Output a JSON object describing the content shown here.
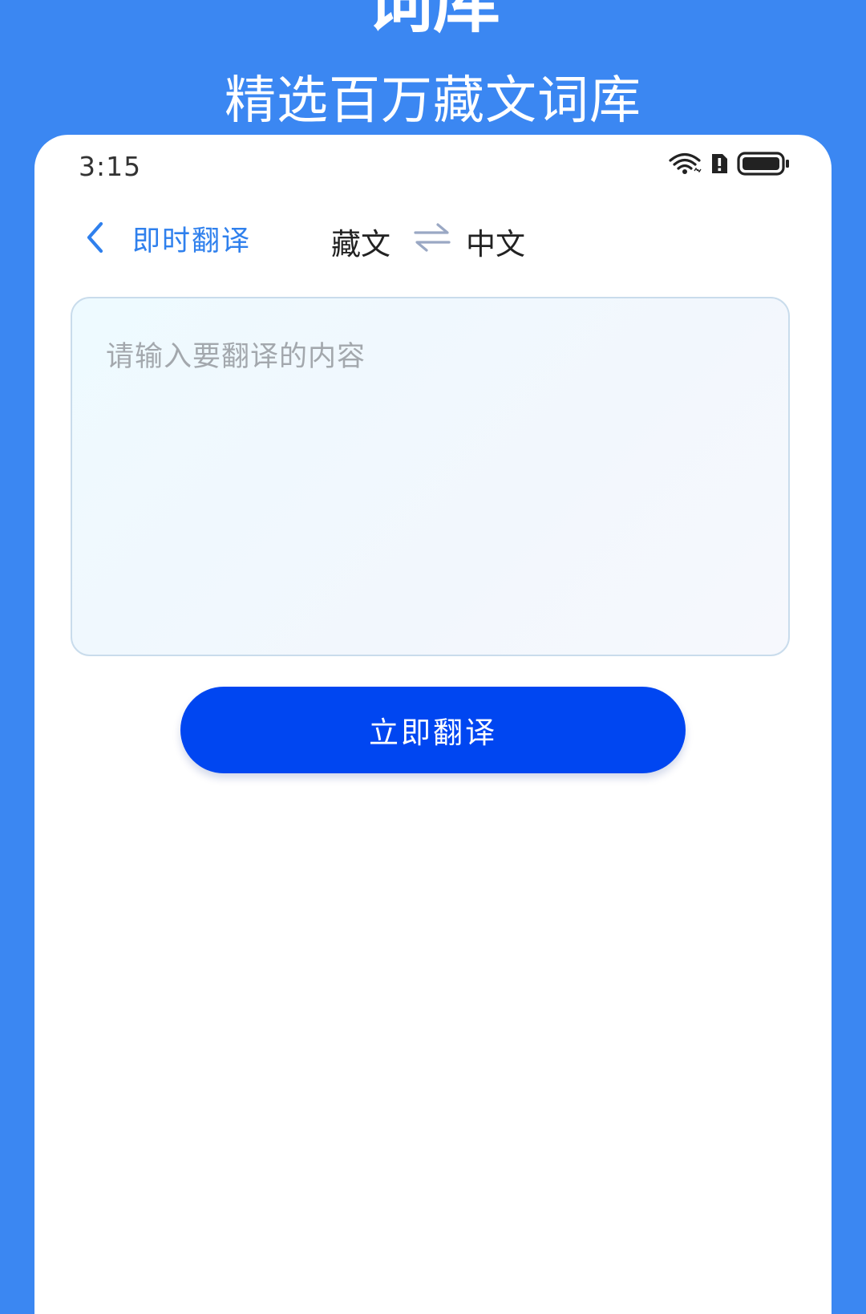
{
  "promo": {
    "heading": "词库",
    "subtitle": "精选百万藏文词库"
  },
  "status_bar": {
    "time": "3:15",
    "icons": [
      "wifi-icon",
      "alert-icon",
      "battery-icon"
    ]
  },
  "nav": {
    "back_icon": "chevron-left-icon",
    "title": "即时翻译",
    "source_language": "藏文",
    "swap_icon": "swap-arrows-icon",
    "target_language": "中文"
  },
  "input": {
    "value": "",
    "placeholder": "请输入要翻译的内容"
  },
  "actions": {
    "translate_label": "立即翻译"
  },
  "colors": {
    "background": "#3b87f2",
    "card": "#ffffff",
    "nav_title": "#2f80ed",
    "primary_button": "#0046f1",
    "input_border": "#c9dcec",
    "placeholder": "#a3a8ad",
    "swap_icon": "#9aa8c4"
  }
}
